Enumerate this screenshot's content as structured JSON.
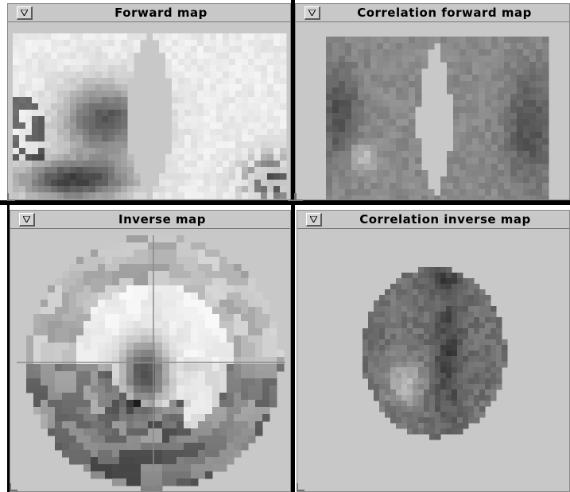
{
  "windows": [
    {
      "id": "forward-map",
      "title": "Forward map",
      "menu_icon": "down-triangle-icon"
    },
    {
      "id": "correlation-forward-map",
      "title": "Correlation forward map",
      "menu_icon": "down-triangle-icon"
    },
    {
      "id": "inverse-map",
      "title": "Inverse map",
      "menu_icon": "down-triangle-icon"
    },
    {
      "id": "correlation-inverse-map",
      "title": "Correlation inverse map",
      "menu_icon": "down-triangle-icon"
    }
  ],
  "colors": {
    "window_bg": "#c8c8c8",
    "divider": "#000000",
    "crosshair": "#8a8a8a"
  }
}
